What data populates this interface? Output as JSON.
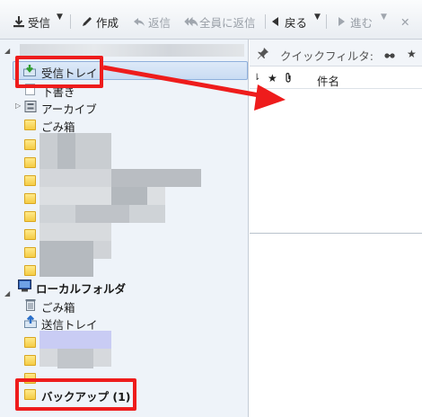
{
  "toolbar": {
    "get_mail": "受信",
    "compose": "作成",
    "reply": "返信",
    "reply_all": "全員に返信",
    "back": "戻る",
    "forward": "進む",
    "delete_partial": "✕"
  },
  "quick_filter": {
    "label": "クイックフィルタ:",
    "toggle_icon": "glasses-icon"
  },
  "message_list": {
    "col_subject": "件名"
  },
  "folders": {
    "inbox": "受信トレイ",
    "drafts": "下書き",
    "archive": "アーカイブ",
    "trash": "ごみ箱",
    "local_folders": "ローカルフォルダ",
    "local_trash": "ごみ箱",
    "outbox": "送信トレイ",
    "backup": "バックアップ (1)"
  },
  "colors": {
    "annotation_red": "#ee1c1c",
    "selection_blue": "#c9dcf3",
    "pane_bg": "#eef3f9"
  }
}
